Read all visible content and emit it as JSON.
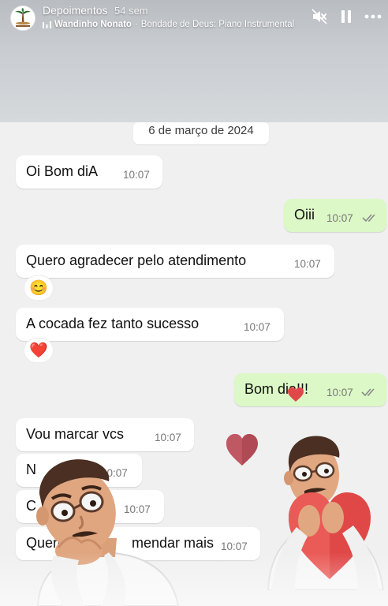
{
  "story": {
    "account_name": "Depoimentos",
    "time_ago": "54 sem",
    "music": {
      "artist": "Wandinho Nonato",
      "separator": "·",
      "track": "Bondade de Deus: Piano Instrumental"
    },
    "icons": [
      "mute-icon",
      "pause-icon",
      "more-icon"
    ]
  },
  "chat": {
    "date": "6 de março de 2024",
    "messages": [
      {
        "direction": "in",
        "text": "Oi Bom diA",
        "time": "10:07"
      },
      {
        "direction": "out",
        "text": "Oiii",
        "time": "10:07",
        "read": true
      },
      {
        "direction": "in",
        "text": "Quero agradecer pelo atendimento",
        "time": "10:07",
        "reaction": "😊"
      },
      {
        "direction": "in",
        "text": "A cocada fez tanto sucesso",
        "time": "10:07",
        "reaction": "❤️"
      },
      {
        "direction": "out",
        "text": "Bom dia!!!",
        "time": "10:07",
        "read": true
      },
      {
        "direction": "in",
        "text": "Vou marcar vcs",
        "time": "10:07"
      },
      {
        "direction": "in",
        "text": "N",
        "time": "10:07"
      },
      {
        "direction": "in",
        "text": "C",
        "time": "10:07"
      },
      {
        "direction": "in",
        "text": "Quero",
        "text_end": "mendar mais",
        "time": "10:07"
      }
    ]
  },
  "colors": {
    "incoming_bubble": "#ffffff",
    "outgoing_bubble": "#dcf8c6",
    "chat_background": "#f0f0f0",
    "read_ticks": "#8a8a8a",
    "heart": "#e04848"
  }
}
